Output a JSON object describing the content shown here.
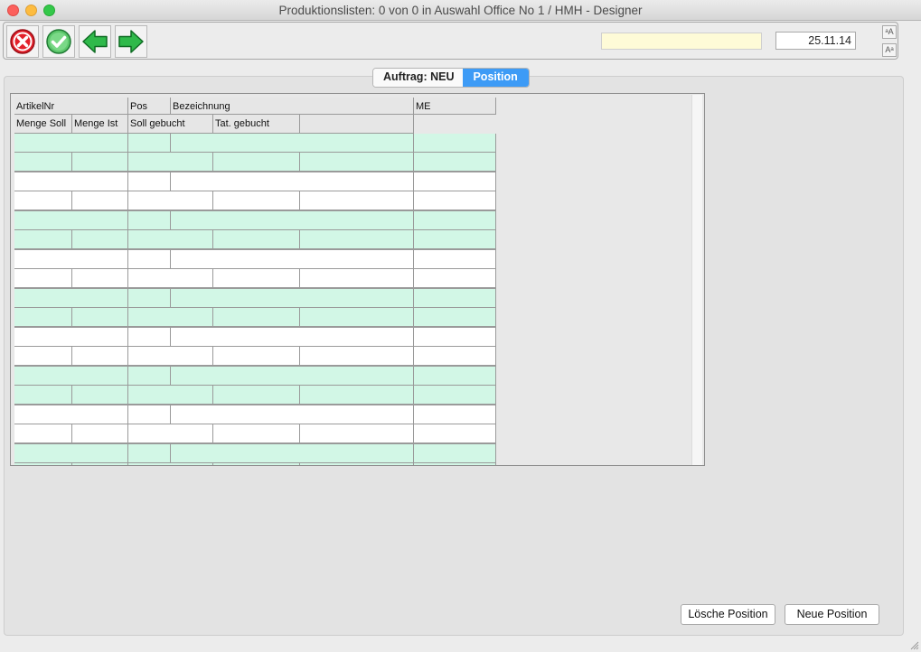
{
  "window": {
    "title": "Produktionslisten: 0 von 0 in Auswahl Office No 1 /  HMH - Designer"
  },
  "toolbar": {
    "buttons": [
      {
        "name": "cancel-button",
        "icon": "red-x-circle-icon"
      },
      {
        "name": "confirm-button",
        "icon": "green-check-circle-icon"
      },
      {
        "name": "previous-button",
        "icon": "green-left-arrow-icon"
      },
      {
        "name": "next-button",
        "icon": "green-right-arrow-icon"
      }
    ],
    "search_value": "",
    "date_value": "25.11.14",
    "font_up_label": "ᵃA",
    "font_down_label": "Aᵃ"
  },
  "tabs": [
    {
      "label": "Auftrag: NEU",
      "active": false
    },
    {
      "label": "Position",
      "active": true
    }
  ],
  "grid": {
    "header_row1": [
      "ArtikelNr",
      "Pos",
      "Bezeichnung",
      "ME"
    ],
    "header_row2": [
      "Menge Soll",
      "Menge Ist",
      "Soll gebucht",
      "Tat. gebucht",
      ""
    ],
    "row_colors": [
      "green",
      "white",
      "green",
      "white",
      "green",
      "white",
      "green",
      "white",
      "green"
    ]
  },
  "buttons": {
    "delete_position": "Lösche Position",
    "new_position": "Neue Position"
  },
  "colors": {
    "row_green": "#d2f7e6",
    "row_white": "#ffffff",
    "tab_active": "#3d9bf6",
    "input_yellow": "#fefbd7"
  }
}
